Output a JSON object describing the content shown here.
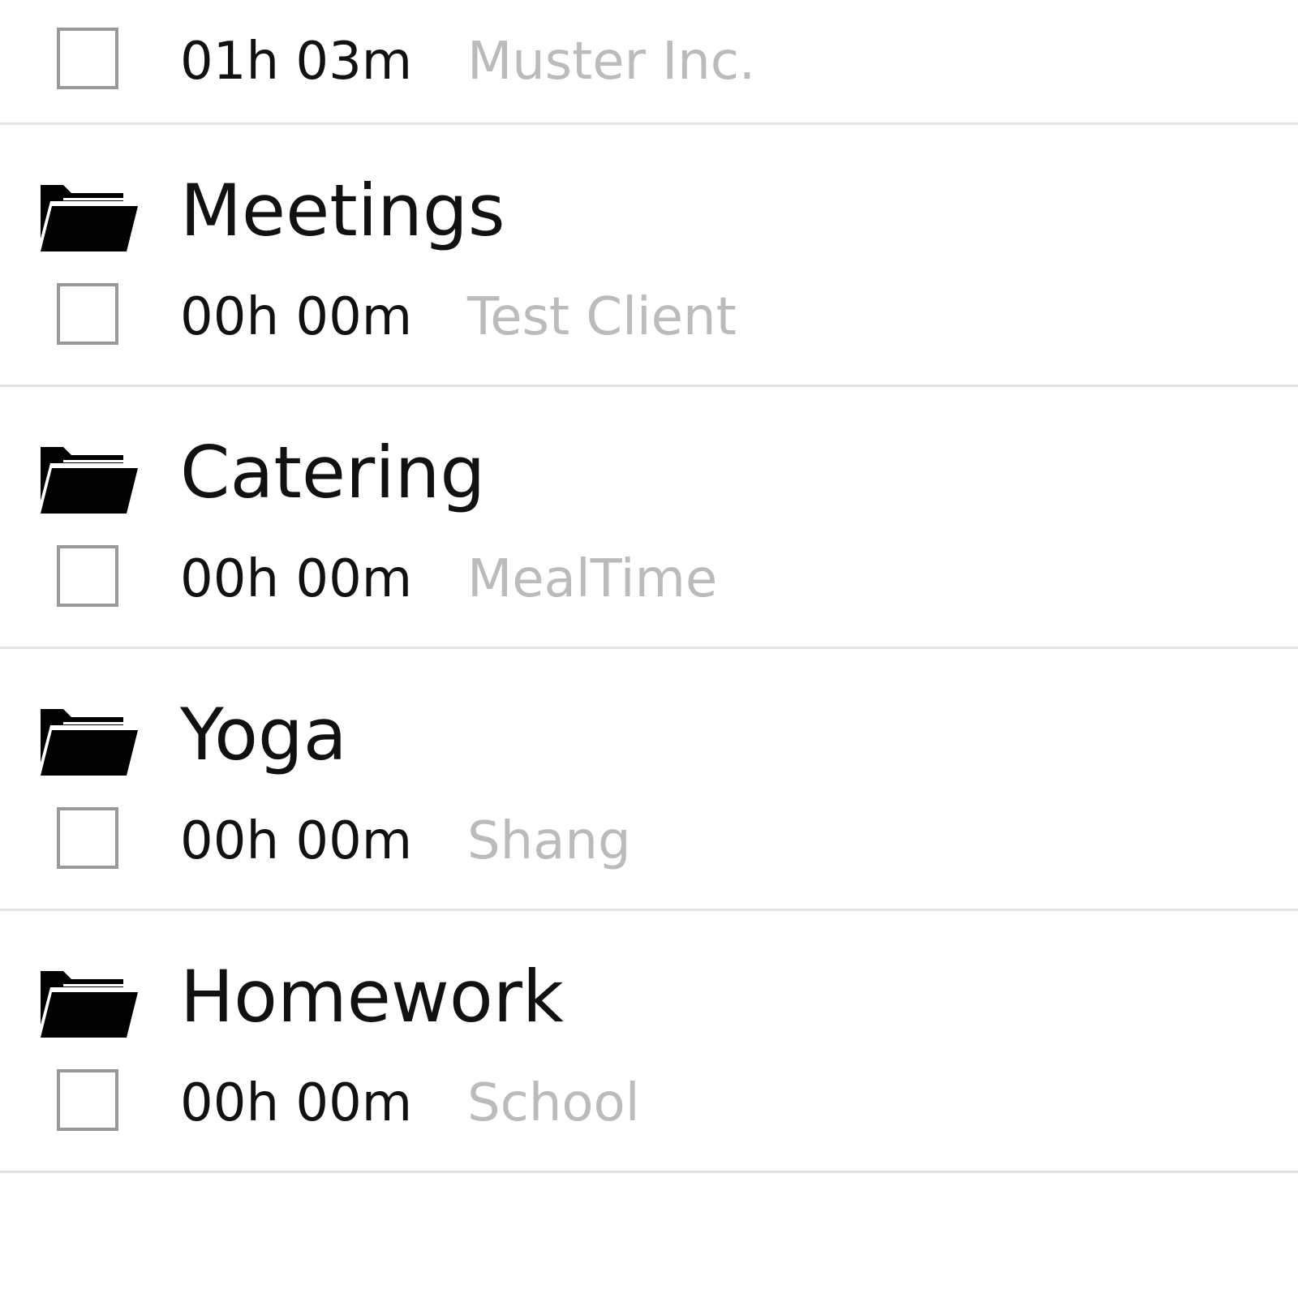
{
  "colors": {
    "text_primary": "#111111",
    "text_client": "#bbbbbb",
    "divider": "#e4e4e4",
    "checkbox_border": "#999999"
  },
  "icons": {
    "project": "folder-open-icon",
    "task_toggle": "checkbox-unchecked"
  },
  "projects": [
    {
      "name": "",
      "time": "01h 03m",
      "client": "Muster Inc.",
      "checked": false
    },
    {
      "name": "Meetings",
      "time": "00h 00m",
      "client": "Test Client",
      "checked": false
    },
    {
      "name": "Catering",
      "time": "00h 00m",
      "client": "MealTime",
      "checked": false
    },
    {
      "name": "Yoga",
      "time": "00h 00m",
      "client": "Shang",
      "checked": false
    },
    {
      "name": "Homework",
      "time": "00h 00m",
      "client": "School",
      "checked": false
    }
  ]
}
